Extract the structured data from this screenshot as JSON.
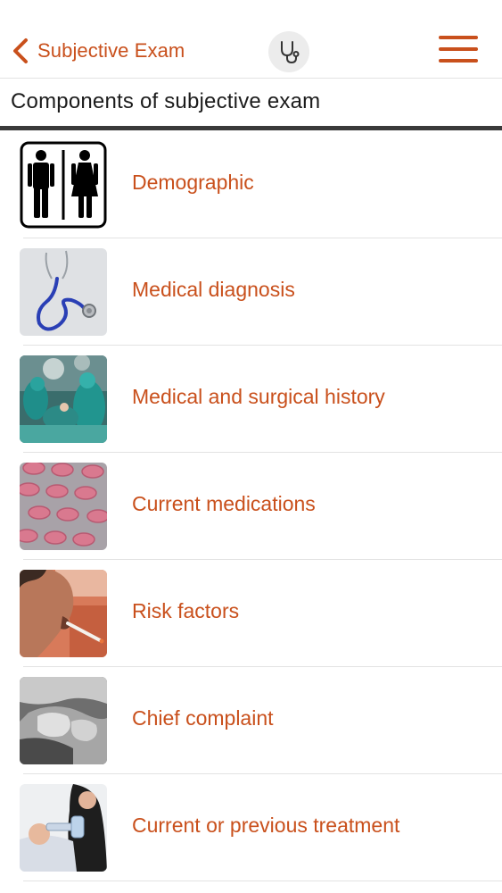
{
  "header": {
    "back_label": "Subjective Exam",
    "back_icon": "chevron-left-icon",
    "center_icon": "stethoscope-icon",
    "menu_icon": "hamburger-menu-icon"
  },
  "section": {
    "title": "Components of subjective exam"
  },
  "items": [
    {
      "label": "Demographic",
      "icon": "restroom-sign-icon"
    },
    {
      "label": "Medical diagnosis",
      "icon": "stethoscope-photo"
    },
    {
      "label": "Medical and surgical history",
      "icon": "surgery-photo"
    },
    {
      "label": "Current medications",
      "icon": "pills-photo"
    },
    {
      "label": "Risk factors",
      "icon": "smoking-photo"
    },
    {
      "label": "Chief complaint",
      "icon": "chest-pain-photo"
    },
    {
      "label": "Current or previous treatment",
      "icon": "inhaler-treatment-photo"
    }
  ],
  "colors": {
    "accent": "#c9501c",
    "text": "#1c1c1c",
    "divider": "#e3e3e3"
  }
}
